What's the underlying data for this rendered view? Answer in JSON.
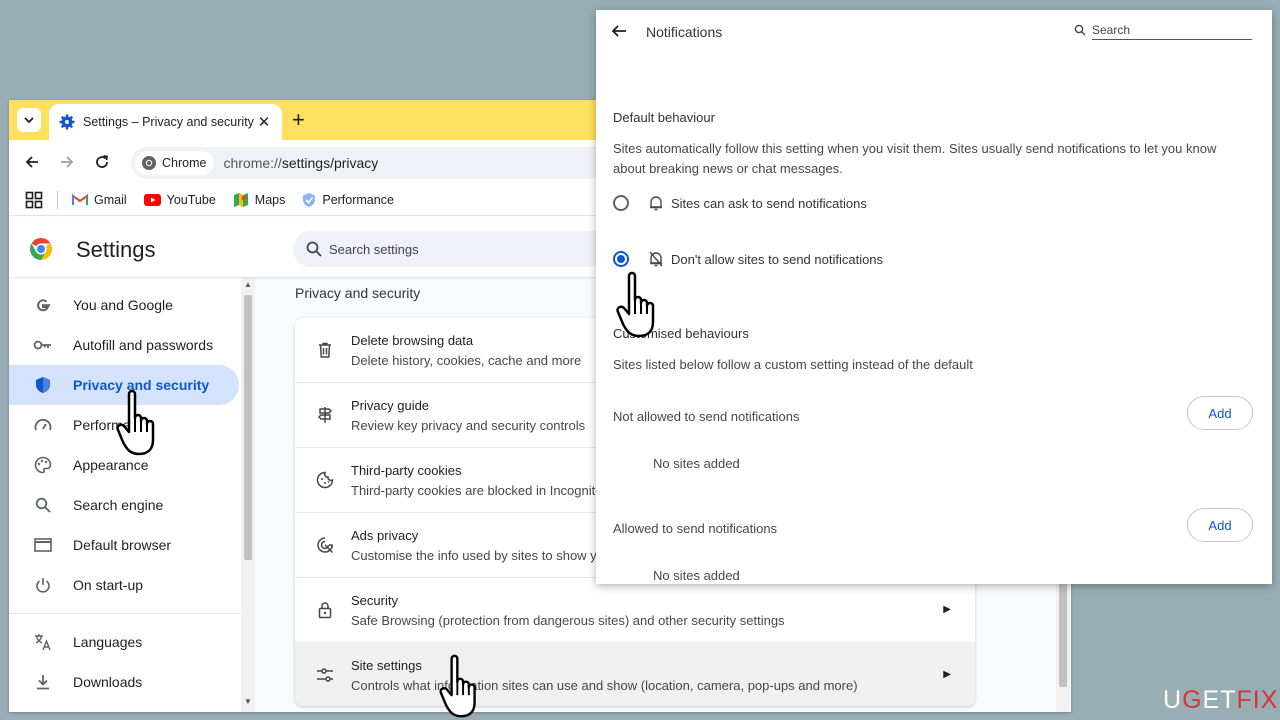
{
  "tab": {
    "title": "Settings – Privacy and security",
    "close": "✕",
    "newtab": "+"
  },
  "omnibox": {
    "chip": "Chrome",
    "url_prefix": "chrome://",
    "url_rest": "settings/privacy"
  },
  "bookmarks": [
    {
      "label": "Gmail",
      "icon": "gmail-icon"
    },
    {
      "label": "YouTube",
      "icon": "youtube-icon"
    },
    {
      "label": "Maps",
      "icon": "maps-icon"
    },
    {
      "label": "Performance",
      "icon": "performance-icon"
    }
  ],
  "settings": {
    "title": "Settings",
    "search_placeholder": "Search settings"
  },
  "sidebar": {
    "items": [
      {
        "label": "You and Google",
        "icon": "google-icon"
      },
      {
        "label": "Autofill and passwords",
        "icon": "key-icon"
      },
      {
        "label": "Privacy and security",
        "icon": "shield-icon",
        "active": true
      },
      {
        "label": "Performance",
        "icon": "speedometer-icon"
      },
      {
        "label": "Appearance",
        "icon": "palette-icon"
      },
      {
        "label": "Search engine",
        "icon": "search-icon"
      },
      {
        "label": "Default browser",
        "icon": "browser-window-icon"
      },
      {
        "label": "On start-up",
        "icon": "power-icon"
      },
      {
        "label": "Languages",
        "icon": "translate-icon"
      },
      {
        "label": "Downloads",
        "icon": "download-icon"
      }
    ]
  },
  "content": {
    "section_title": "Privacy and security",
    "rows": [
      {
        "title": "Delete browsing data",
        "subtitle": "Delete history, cookies, cache and more",
        "icon": "trash-icon"
      },
      {
        "title": "Privacy guide",
        "subtitle": "Review key privacy and security controls",
        "icon": "signpost-icon"
      },
      {
        "title": "Third-party cookies",
        "subtitle": "Third-party cookies are blocked in Incognito mode",
        "icon": "cookie-icon"
      },
      {
        "title": "Ads privacy",
        "subtitle": "Customise the info used by sites to show you ads",
        "icon": "ads-target-icon"
      },
      {
        "title": "Security",
        "subtitle": "Safe Browsing (protection from dangerous sites) and other security settings",
        "icon": "lock-icon"
      },
      {
        "title": "Site settings",
        "subtitle": "Controls what information sites can use and show (location, camera, pop-ups and more)",
        "icon": "sliders-icon"
      }
    ]
  },
  "notifications": {
    "title": "Notifications",
    "search_placeholder": "Search",
    "default_heading": "Default behaviour",
    "default_desc": "Sites automatically follow this setting when you visit them. Sites usually send notifications to let you know about breaking news or chat messages.",
    "option_ask": "Sites can ask to send notifications",
    "option_block": "Don't allow sites to send notifications",
    "selected_option": "option_block",
    "custom_heading": "Customised behaviours",
    "custom_desc": "Sites listed below follow a custom setting instead of the default",
    "not_allowed_label": "Not allowed to send notifications",
    "allowed_label": "Allowed to send notifications",
    "add_label": "Add",
    "no_sites": "No sites added"
  },
  "watermark": {
    "part1": "U",
    "part2": "G",
    "part3": "ET",
    "part4": "FIX"
  },
  "colors": {
    "accent": "#0b57d0",
    "tabstrip": "#fde05d",
    "active_bg": "#d3e3fd",
    "desktop": "#98adb4"
  }
}
